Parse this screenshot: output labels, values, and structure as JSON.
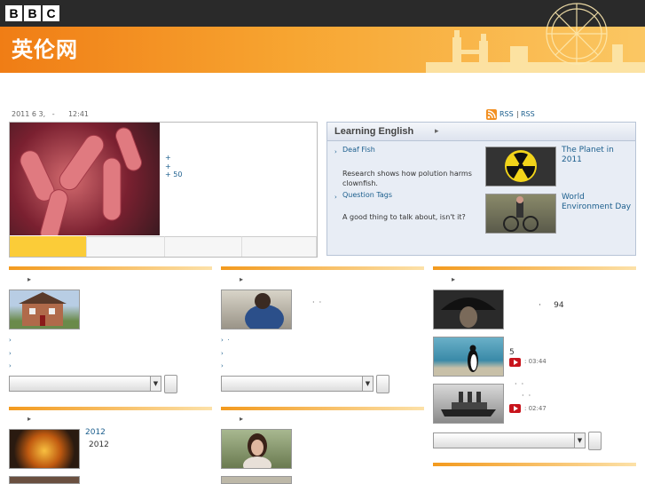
{
  "header": {
    "bbc_letters": [
      "B",
      "B",
      "C"
    ],
    "site_name": "英伦网"
  },
  "dateline": "2011 6 3,   -      12:41",
  "rss": {
    "label1": "RSS",
    "sep": "|",
    "label2": "RSS"
  },
  "feature": {
    "bullets": [
      "+",
      "+",
      "+ 50"
    ],
    "tabs": [
      "",
      "",
      "",
      ""
    ]
  },
  "learning": {
    "title": "Learning English",
    "arrow": "▸",
    "items": [
      {
        "title": "Deaf Fish",
        "desc": "Research shows how polution harms clownfish."
      },
      {
        "title": "Question Tags",
        "desc": "A good thing to talk about, isn't it?"
      }
    ],
    "side": [
      {
        "title": "The Planet in 2011"
      },
      {
        "title": "World Environment Day"
      }
    ]
  },
  "col1": {
    "arrow": "▸",
    "bullets": [
      "›",
      "›",
      "›"
    ]
  },
  "col2": {
    "arrow": "▸",
    "caption": "·  ·",
    "bullets": [
      "›  ·",
      "›",
      "›"
    ]
  },
  "col3": {
    "arrow": "▸",
    "items": [
      {
        "caption": "·     94"
      },
      {
        "caption": "5",
        "duration": ": 03:44"
      },
      {
        "caption": "·  ·",
        "caption2": "·  ·",
        "duration": ": 02:47"
      }
    ]
  },
  "row2": {
    "col1": {
      "arrow": "▸",
      "link": "2012",
      "text": "2012"
    },
    "col2": {
      "arrow": "▸"
    }
  },
  "icons": {
    "rss": "rss-icon",
    "play": "play-icon",
    "arrow": "arrow-right-icon",
    "dropdown": "chevron-down-icon"
  },
  "colors": {
    "accent": "#f39a1e",
    "link": "#1b5e8d",
    "panel": "#e8edf5",
    "play": "#c8141c"
  }
}
